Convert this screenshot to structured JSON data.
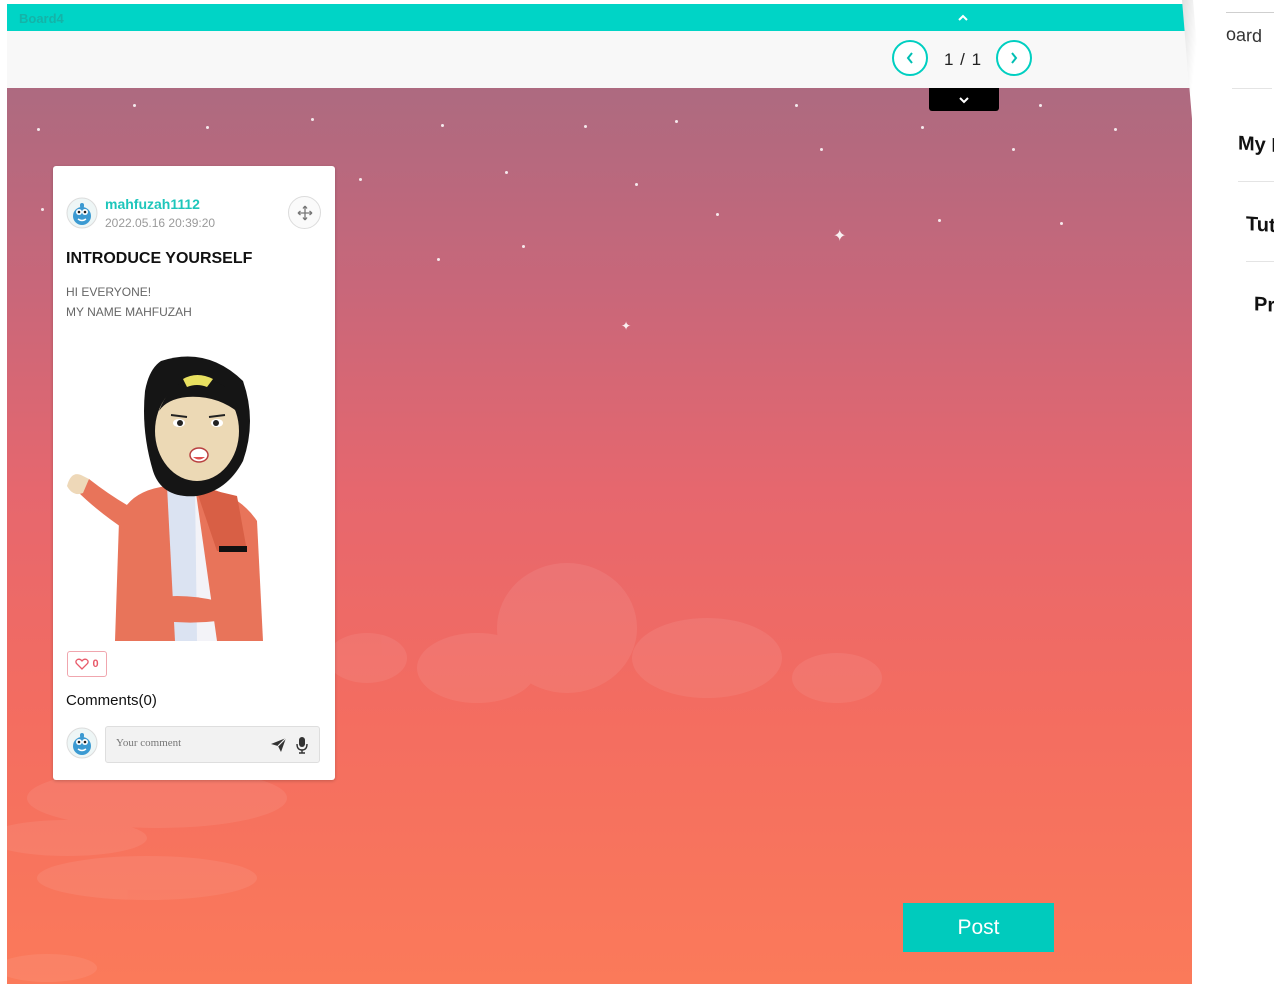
{
  "board": {
    "title": "Board4"
  },
  "pager": {
    "indicator": "1 / 1"
  },
  "post": {
    "username": "mahfuzah1112",
    "timestamp": "2022.05.16 20:39:20",
    "title": "INTRODUCE YOURSELF",
    "body_lines": [
      "HI EVERYONE!",
      "MY NAME MAHFUZAH"
    ],
    "likes": "0",
    "comments_label": "Comments(0)",
    "comment_placeholder": "Your comment"
  },
  "actions": {
    "post_label": "Post"
  },
  "side_panel": {
    "items": [
      "oard",
      "My B",
      "Tut",
      "Pr"
    ]
  },
  "colors": {
    "accent": "#00cbbd",
    "like": "#e85a6a"
  },
  "icons": [
    "chevron-up-icon",
    "chevron-left-icon",
    "chevron-right-icon",
    "chevron-down-icon",
    "move-icon",
    "heart-icon",
    "send-icon",
    "mic-icon"
  ]
}
